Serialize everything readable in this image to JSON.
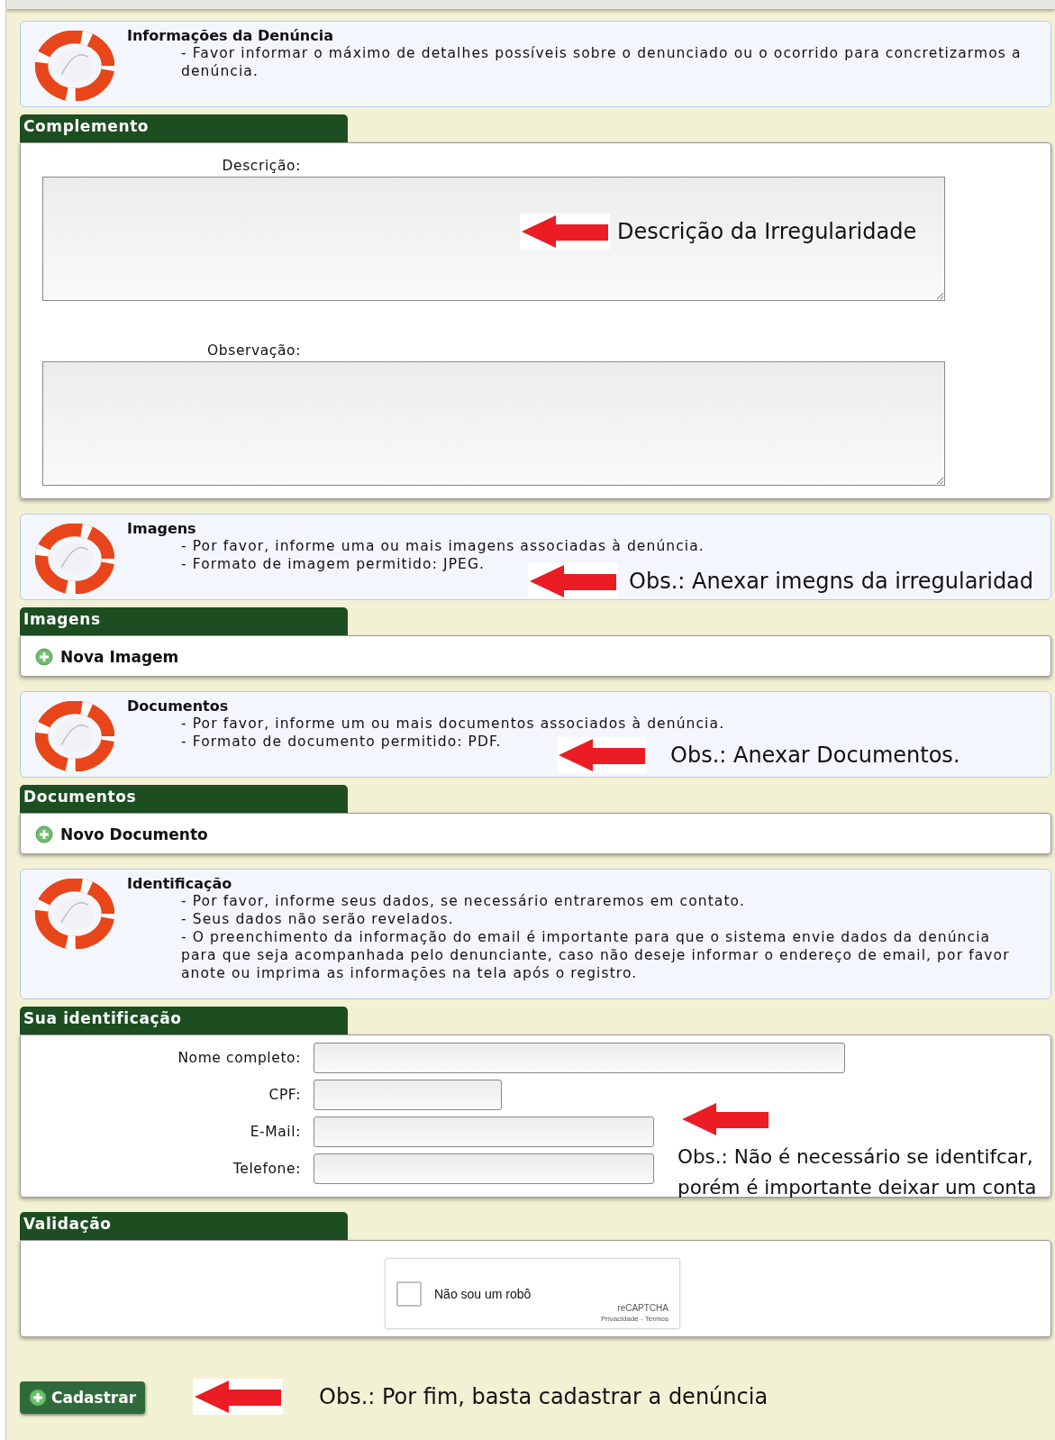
{
  "sections": [
    {
      "kind": "info",
      "title": "Informações da Denúncia",
      "lines": [
        "- Favor informar o máximo de detalhes possíveis sobre o denunciado ou o ocorrido para concretizarmos a denúncia."
      ]
    },
    {
      "kind": "textareas",
      "header": "Complemento",
      "fields": [
        {
          "label": "Descrição:"
        },
        {
          "label": "Observação:"
        }
      ]
    },
    {
      "kind": "info",
      "title": "Imagens",
      "lines": [
        "- Por favor, informe uma ou mais imagens associadas à denúncia.",
        "- Formato de imagem permitido: JPEG."
      ]
    },
    {
      "kind": "add",
      "header": "Imagens",
      "link": "Nova Imagem"
    },
    {
      "kind": "info",
      "title": "Documentos",
      "lines": [
        "- Por favor, informe um ou mais documentos associados à denúncia.",
        "- Formato de documento permitido: PDF."
      ]
    },
    {
      "kind": "add",
      "header": "Documentos",
      "link": "Novo Documento"
    },
    {
      "kind": "info",
      "title": "Identificação",
      "lines": [
        "- Por favor, informe seus dados, se necessário entraremos em contato.",
        "- Seus dados não serão revelados.",
        "- O preenchimento da informação do email é importante para que o sistema envie dados da denúncia para que seja acompanhada pelo denunciante, caso não deseje informar o endereço de email, por favor anote ou imprima as informações na tela após o registro."
      ]
    },
    {
      "kind": "fields",
      "header": "Sua identificação",
      "fields": [
        {
          "label": "Nome completo:"
        },
        {
          "label": "CPF:"
        },
        {
          "label": "E-Mail:"
        },
        {
          "label": "Telefone:"
        }
      ]
    },
    {
      "kind": "captcha",
      "header": "Validação",
      "checkbox": {
        "label": "Não sou um robô",
        "checked": false
      },
      "brand": "reCAPTCHA",
      "links": "Privacidade - Termos"
    }
  ],
  "submit": "Cadastrar",
  "annotations": [
    {
      "lines": [
        "Descrição da Irregularidade"
      ]
    },
    {
      "lines": [
        "Obs.: Anexar imegns da irregularidad"
      ]
    },
    {
      "lines": [
        "Obs.: Anexar Documentos."
      ]
    },
    {
      "lines": [
        "Obs.: Não é necessário se identifcar,",
        "porém é importante deixar um conta"
      ]
    },
    {
      "lines": [
        "Obs.: Por fim, basta cadastrar a denúncia"
      ]
    }
  ]
}
